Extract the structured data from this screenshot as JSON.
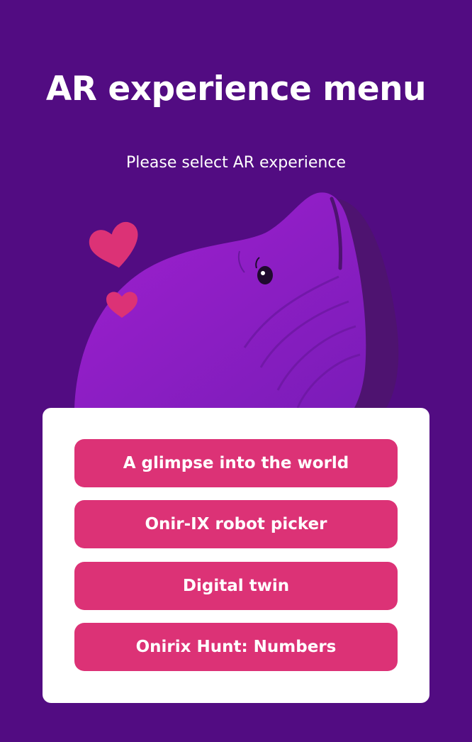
{
  "header": {
    "title": "AR experience menu",
    "subtitle": "Please select AR experience"
  },
  "illustration": {
    "icon": "whale-icon",
    "hearts": [
      "heart-icon",
      "heart-icon"
    ]
  },
  "menu": {
    "items": [
      {
        "label": "A glimpse into the world"
      },
      {
        "label": "Onir-IX robot picker"
      },
      {
        "label": "Digital twin"
      },
      {
        "label": "Onirix Hunt: Numbers"
      }
    ]
  },
  "colors": {
    "background": "#520c82",
    "whale": "#8a1fc4",
    "whale_shadow": "#4e1370",
    "heart": "#dc3276",
    "button": "#dc3276",
    "card": "#ffffff",
    "text": "#ffffff"
  }
}
